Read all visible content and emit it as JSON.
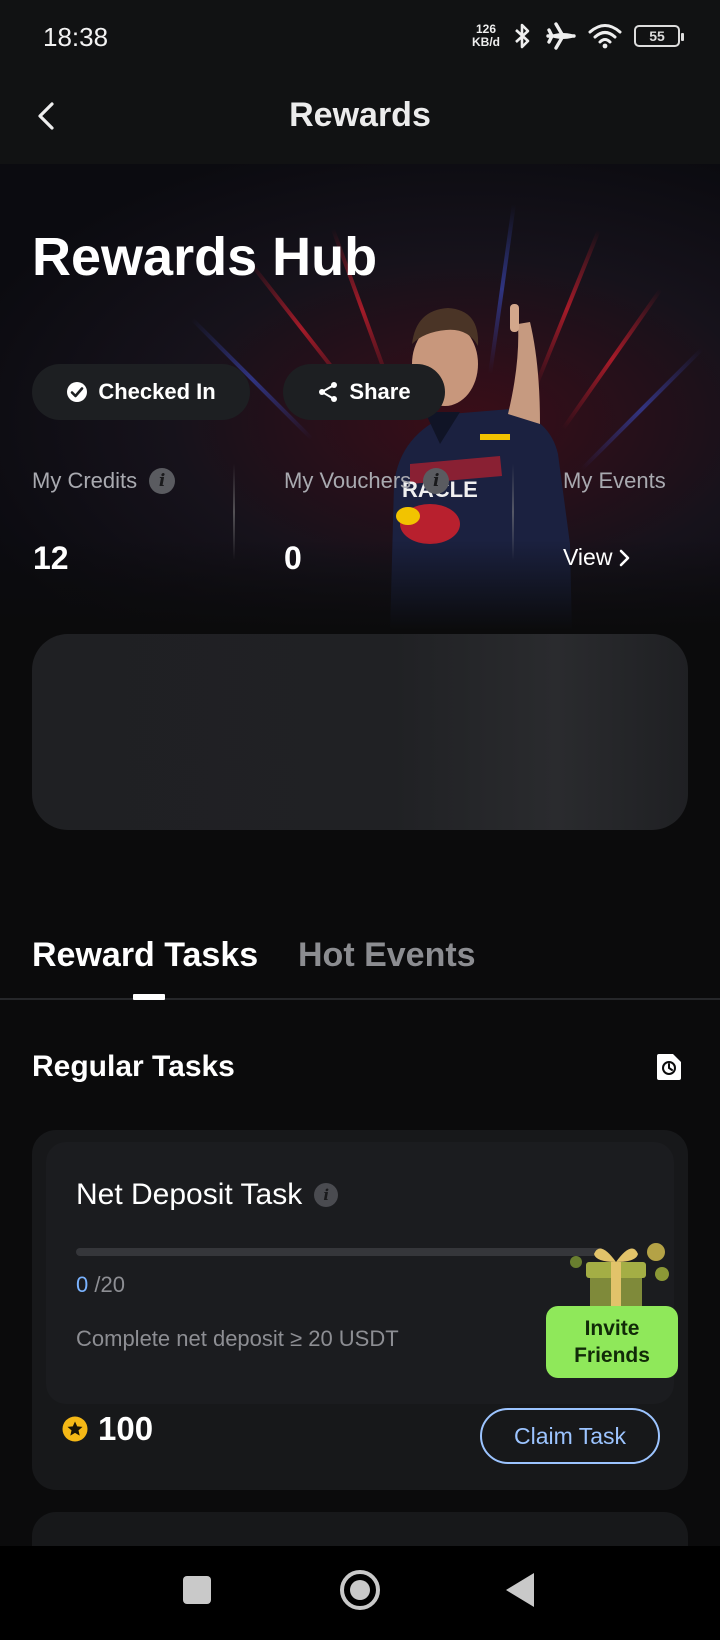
{
  "status_bar": {
    "time": "18:38",
    "net_speed_value": "126",
    "net_speed_unit": "KB/d",
    "battery": "55",
    "icons": [
      "bluetooth-icon",
      "airplane-icon",
      "wifi-icon",
      "battery-icon"
    ]
  },
  "header": {
    "title": "Rewards",
    "back_icon": "chevron-left-icon"
  },
  "hero": {
    "title": "Rewards Hub",
    "checked_in_label": "Checked In",
    "share_label": "Share",
    "stats": [
      {
        "label": "My Credits",
        "value": "12"
      },
      {
        "label": "My Vouchers",
        "value": "0"
      },
      {
        "label": "My Events",
        "link": "View"
      }
    ],
    "sponsor_text": "RACLE"
  },
  "tabs": {
    "active": "Reward Tasks",
    "inactive": "Hot Events"
  },
  "regular_tasks": {
    "title": "Regular Tasks",
    "history_icon": "history-icon",
    "task": {
      "title": "Net Deposit Task",
      "progress_current": "0",
      "progress_total": " /20",
      "progress_fraction": 0,
      "description": "Complete net deposit ≥ 20 USDT",
      "reward": "100",
      "claim_label": "Claim Task"
    },
    "invite_label_line1": "Invite",
    "invite_label_line2": "Friends"
  },
  "colors": {
    "accent_blue": "#9cc4ff",
    "invite_green": "#8fe85a",
    "coin_gold": "#f5b816",
    "background": "#0b0b0c"
  }
}
